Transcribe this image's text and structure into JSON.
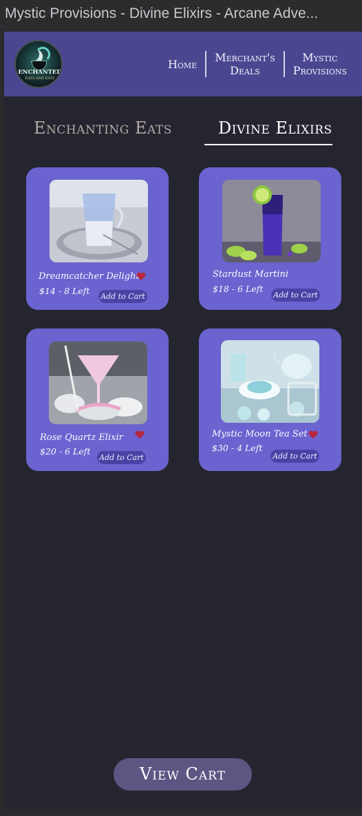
{
  "window": {
    "title": "Mystic Provisions - Divine Elixirs - Arcane Adve..."
  },
  "logo": {
    "line1": "ENCHANTED",
    "line2": "EATS AND EATS",
    "icon": "cauldron-moon-logo"
  },
  "nav": {
    "home": "Home",
    "deals_line1": "Merchant's",
    "deals_line2": "Deals",
    "provisions_line1": "Mystic",
    "provisions_line2": "Provisions"
  },
  "tabs": {
    "eats": "Enchanting Eats",
    "elixirs": "Divine Elixirs",
    "active": "elixirs"
  },
  "colors": {
    "header": "#4a4790",
    "card": "#6b63cf",
    "heart": "#b8263e",
    "cart_button": "#5b5682"
  },
  "products": [
    {
      "name": "Dreamcatcher Delight",
      "price": "$14",
      "sep": "-",
      "stock": "8 Left",
      "add_label": "Add to Cart",
      "favorite": true
    },
    {
      "name": "Stardust Martini",
      "price": "$18",
      "sep": "-",
      "stock": "6 Left",
      "add_label": "Add to Cart",
      "favorite": false
    },
    {
      "name": "Rose Quartz Elixir",
      "price": "$20",
      "sep": "-",
      "stock": "6 Left",
      "add_label": "Add to Cart",
      "favorite": true
    },
    {
      "name": "Mystic Moon Tea Set",
      "price": "$30",
      "sep": "-",
      "stock": "4 Left",
      "add_label": "Add to Cart",
      "favorite": true
    }
  ],
  "cart": {
    "label": "View Cart"
  }
}
